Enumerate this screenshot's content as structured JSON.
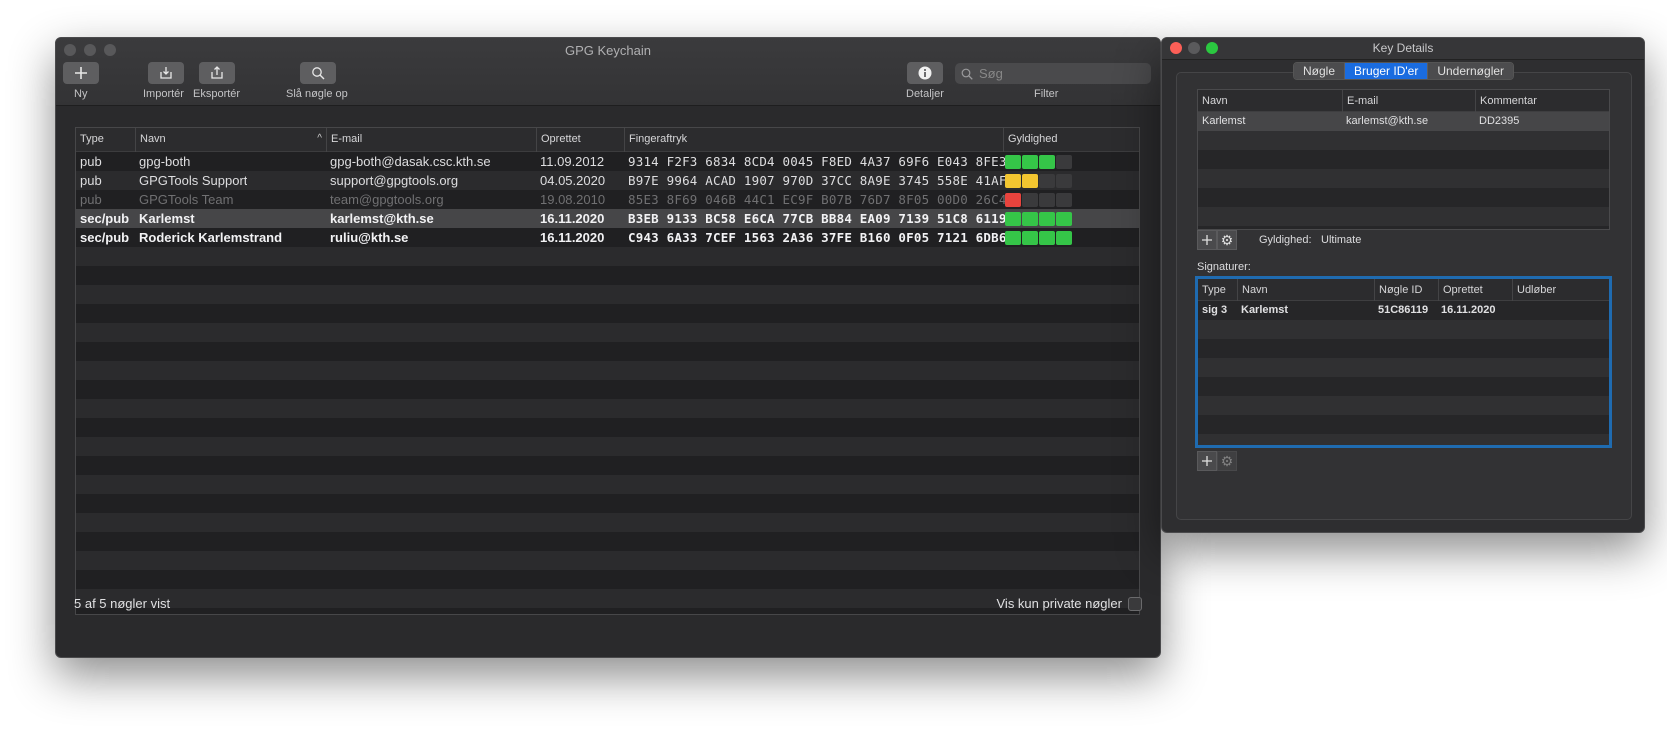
{
  "main_window": {
    "title": "GPG Keychain",
    "toolbar": {
      "new_label": "Ny",
      "import_label": "Importér",
      "export_label": "Eksportér",
      "lookup_label": "Slå nøgle op",
      "details_label": "Detaljer",
      "filter_label": "Filter",
      "search_placeholder": "Søg"
    },
    "table": {
      "columns": [
        "Type",
        "Navn",
        "E-mail",
        "Oprettet",
        "Fingeraftryk",
        "Gyldighed"
      ],
      "rows": [
        {
          "type": "pub",
          "name": "gpg-both",
          "email": "gpg-both@dasak.csc.kth.se",
          "created": "11.09.2012",
          "fingerprint": "9314 F2F3 6834 8CD4 0045  F8ED 4A37 69F6 E043 8FE3",
          "validity": "3 of 4",
          "style": "normal"
        },
        {
          "type": "pub",
          "name": "GPGTools Support",
          "email": "support@gpgtools.org",
          "created": "04.05.2020",
          "fingerprint": "B97E 9964 ACAD 1907 970D  37CC 8A9E 3745 558E 41AF",
          "validity": "2 of 4",
          "style": "normal"
        },
        {
          "type": "pub",
          "name": "GPGTools Team",
          "email": "team@gpgtools.org",
          "created": "19.08.2010",
          "fingerprint": "85E3 8F69 046B 44C1 EC9F  B07B 76D7 8F05 00D0 26C4",
          "validity": "1 of 4",
          "style": "dim"
        },
        {
          "type": "sec/pub",
          "name": "Karlemst",
          "email": "karlemst@kth.se",
          "created": "16.11.2020",
          "fingerprint": "B3EB 9133 BC58 E6CA 77CB  BB84 EA09 7139 51C8 6119",
          "validity": "4 of 4",
          "style": "bold-selected"
        },
        {
          "type": "sec/pub",
          "name": "Roderick Karlemstrand",
          "email": "ruliu@kth.se",
          "created": "16.11.2020",
          "fingerprint": "C943 6A33 7CEF 1563 2A36  37FE B160 0F05 7121 6DB6",
          "validity": "4 of 4",
          "style": "bold"
        }
      ]
    },
    "status_text": "5 af 5 nøgler vist",
    "private_only_label": "Vis kun private nøgler",
    "colors": {
      "valid_green": "#35c548",
      "partial_yellow": "#f3c630",
      "invalid_red": "#e8433d"
    }
  },
  "details_window": {
    "title": "Key Details",
    "tabs": [
      {
        "label": "Nøgle",
        "active": false
      },
      {
        "label": "Bruger ID'er",
        "active": true
      },
      {
        "label": "Undernøgler",
        "active": false
      }
    ],
    "uid_table": {
      "columns": [
        "Navn",
        "E-mail",
        "Kommentar"
      ],
      "rows": [
        {
          "name": "Karlemst",
          "email": "karlemst@kth.se",
          "comment": "DD2395"
        }
      ]
    },
    "validity_label": "Gyldighed:",
    "validity_value": "Ultimate",
    "signatures_label": "Signaturer:",
    "sig_table": {
      "columns": [
        "Type",
        "Navn",
        "Nøgle ID",
        "Oprettet",
        "Udløber"
      ],
      "rows": [
        {
          "type": "sig 3",
          "name": "Karlemst",
          "key_id": "51C86119",
          "created": "16.11.2020",
          "expires": ""
        }
      ]
    }
  }
}
